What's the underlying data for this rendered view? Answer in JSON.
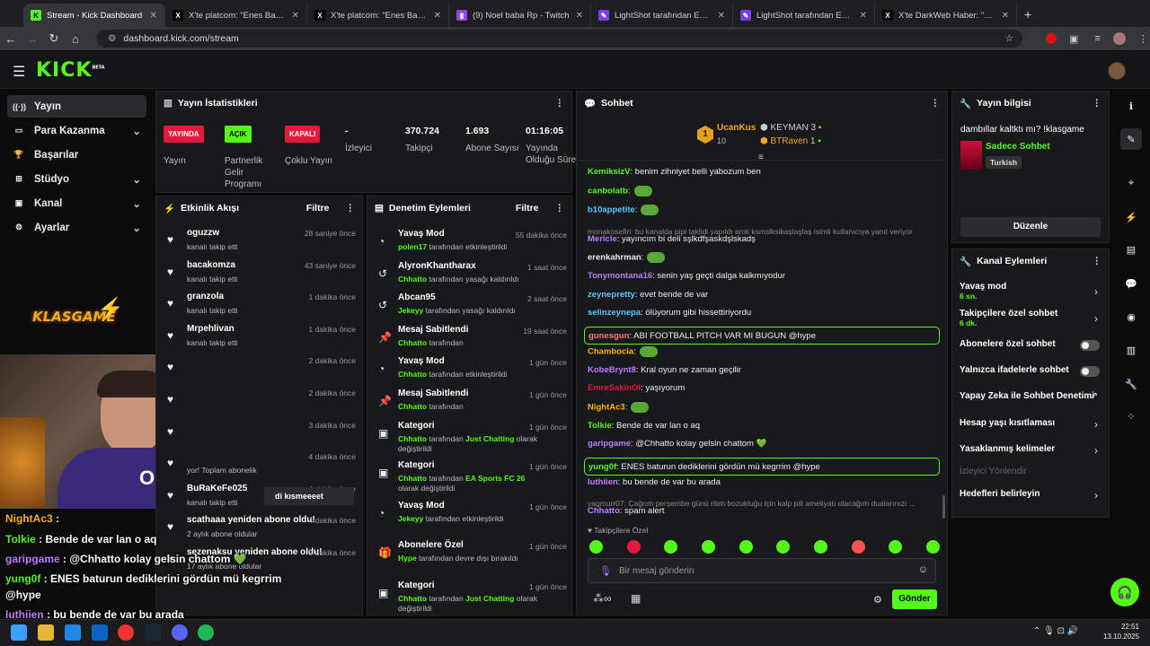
{
  "browser": {
    "tabs": [
      {
        "title": "Stream - Kick Dashboard",
        "active": true,
        "favicon": "kick"
      },
      {
        "title": "X'te platcom: \"Enes Batur, wtch",
        "favicon": "x"
      },
      {
        "title": "X'te platcom: \"Enes Batur, Elrac",
        "favicon": "x"
      },
      {
        "title": "(9) Noel baba Rp - Twitch",
        "favicon": "twitch"
      },
      {
        "title": "LightShot tarafından Ekran Gör",
        "favicon": "lightshot"
      },
      {
        "title": "LightShot tarafından Ekran Gör",
        "favicon": "lightshot"
      },
      {
        "title": "X'te DarkWeb Haber: \"Yerli yap",
        "favicon": "x"
      }
    ],
    "new_tab": "+",
    "url": "dashboard.kick.com/stream"
  },
  "kick": {
    "logo": "KICK",
    "beta": "BETA"
  },
  "nav": {
    "items": [
      {
        "label": "Yayın",
        "icon": "broadcast-icon"
      },
      {
        "label": "Para Kazanma",
        "icon": "money-icon"
      },
      {
        "label": "Başarılar",
        "icon": "trophy-icon"
      },
      {
        "label": "Stüdyo",
        "icon": "studio-icon"
      },
      {
        "label": "Kanal",
        "icon": "channel-icon"
      },
      {
        "label": "Ayarlar",
        "icon": "gear-icon"
      }
    ]
  },
  "stats": {
    "title": "Yayın İstatistikleri",
    "cols": [
      {
        "badge": "YAYINDA",
        "label": "Yayın",
        "color": "#e5193a"
      },
      {
        "badge": "AÇIK",
        "label": "Partnerlik Gelir Programı",
        "color": "#53fc18"
      },
      {
        "badge": "KAPALI",
        "label": "Çoklu Yayın",
        "color": "#e5193a"
      },
      {
        "value": "-",
        "label": "İzleyici"
      },
      {
        "value": "370.724",
        "label": "Takipçi"
      },
      {
        "value": "1.693",
        "label": "Abone Sayısı"
      },
      {
        "value": "01:16:05",
        "label": "Yayında Olduğu Süre"
      }
    ]
  },
  "activity": {
    "title": "Etkinlik Akışı",
    "filter": "Filtre",
    "events": [
      {
        "name": "oguzzw",
        "sub": "kanalı takip etti",
        "time": "28 saniye önce"
      },
      {
        "name": "bacakomza",
        "sub": "kanalı takip etti",
        "time": "43 saniye önce"
      },
      {
        "name": "granzola",
        "sub": "kanalı takip etti",
        "time": "1 dakika önce"
      },
      {
        "name": "Mrpehlivan",
        "sub": "kanalı takip etti",
        "time": "1 dakika önce"
      },
      {
        "name": "",
        "sub": "",
        "time": "2 dakika önce"
      },
      {
        "name": "",
        "sub": "",
        "time": "2 dakika önce"
      },
      {
        "name": "",
        "sub": "",
        "time": "3 dakika önce"
      },
      {
        "name": "",
        "sub": "yor! Toplam abonelik",
        "time": "4 dakika önce"
      },
      {
        "name": "BuRaKeFe025",
        "sub": "kanalı takip etti",
        "time": "4 dakika önce"
      },
      {
        "name": "scathaaa yeniden abone oldu!",
        "sub": "2 aylık abone oldular",
        "time": "4 dakika önce"
      },
      {
        "name": "sezenaksu yeniden abone oldu!",
        "sub": "17 aylık abone oldular",
        "time": "5 dakika önce"
      }
    ],
    "tier_chip": "di kısmeeeet"
  },
  "moderation": {
    "title": "Denetim Eylemleri",
    "filter": "Filtre",
    "items": [
      {
        "name": "Yavaş Mod",
        "who": "polen17",
        "rest": " tarafından etkinleştirildi",
        "time": "55 dakika önce",
        "icon": "slow-mode-icon"
      },
      {
        "name": "AlyronKhantharax",
        "who": "Chhatto",
        "rest": " tarafından yasağı kaldırıldı",
        "time": "1 saat önce",
        "icon": "unban-icon"
      },
      {
        "name": "Abcan95",
        "who": "Jekeyy",
        "rest": " tarafından yasağı kaldırıldı",
        "time": "2 saat önce",
        "icon": "unban-icon"
      },
      {
        "name": "Mesaj Sabitlendi",
        "who": "Chhatto",
        "rest": " tarafından",
        "time": "19 saat önce",
        "icon": "pin-icon"
      },
      {
        "name": "Yavaş Mod",
        "who": "Chhatto",
        "rest": " tarafından etkinleştirildi",
        "time": "1 gün önce",
        "icon": "slow-mode-icon"
      },
      {
        "name": "Mesaj Sabitlendi",
        "who": "Chhatto",
        "rest": " tarafından",
        "time": "1 gün önce",
        "icon": "pin-icon"
      },
      {
        "name": "Kategori",
        "who": "Chhatto",
        "rest": " tarafından ",
        "cat": "Just Chatting",
        "rest2": " olarak değiştirildi",
        "time": "1 gün önce",
        "icon": "category-icon"
      },
      {
        "name": "Kategori",
        "who": "Chhatto",
        "rest": " tarafından ",
        "cat": "EA Sports FC 26",
        "rest2": " olarak değiştirildi",
        "time": "1 gün önce",
        "icon": "category-icon"
      },
      {
        "name": "Yavaş Mod",
        "who": "Jekeyy",
        "rest": " tarafından etkinleştirildi",
        "time": "1 gün önce",
        "icon": "slow-mode-icon"
      },
      {
        "name": "Abonelere Özel",
        "who": "Hype",
        "rest": " tarafından devre dışı bırakıldı",
        "time": "1 gün önce",
        "icon": "gift-icon"
      },
      {
        "name": "Kategori",
        "who": "Chhatto",
        "rest": " tarafından ",
        "cat": "Just Chatting",
        "rest2": " olarak değiştirildi",
        "time": "1 gün önce",
        "icon": "category-icon"
      }
    ]
  },
  "chat": {
    "title": "Sohbet",
    "leaderboard": [
      {
        "rank": "1",
        "name": "UcanKus",
        "count": "10"
      },
      {
        "name": "KEYMAN",
        "count": "3"
      },
      {
        "name": "BTRaven",
        "count": "1"
      }
    ],
    "cutoff": "...",
    "messages": [
      {
        "user": "KemiksizV",
        "color": "#53fc18",
        "text": ": benim zihniyet belli yabozum ben"
      },
      {
        "user": "canbolatb",
        "color": "#53fc18",
        "text": ":",
        "emote": true
      },
      {
        "user": "b10appetite",
        "color": "#5cc8ff",
        "text": ":",
        "emote": true
      },
      {
        "reply": "monakosefiri: bu kanalda pipi taklidi yapıldı amk ksmslksikaşlaşlaş isimli kullanıcıya yanıt veriyor"
      },
      {
        "user": "Mericle",
        "color": "#c07cff",
        "text": ": yayıncım bi deli sşlkdfşaskdşlskadş"
      },
      {
        "user": "erenkahrman",
        "color": "#eeeeee",
        "text": ":",
        "emote": true
      },
      {
        "user": "Tonymontana16",
        "color": "#c07cff",
        "text": ": senin yaş geçti dalga kalkmıyodur"
      },
      {
        "user": "zeynepretty",
        "color": "#5cc8ff",
        "text": ": evet bende de var"
      },
      {
        "user": "selinzeynepa",
        "color": "#5cc8ff",
        "text": ": ölüyorum gibi hissettiriyordu"
      },
      {
        "user": "gunesgun",
        "color": "#ff7a7a",
        "text": ": ABI FOOTBALL PITCH VAR MI BUGUN @hype",
        "highlight": true
      },
      {
        "user": "Chambocia",
        "color": "#ffb020",
        "text": ":",
        "emote": true
      },
      {
        "user": "KobeBrynt8",
        "color": "#c07cff",
        "text": ": Kral oyun ne zaman geçilir"
      },
      {
        "user": "EmreSakinOl",
        "color": "#e5193a",
        "text": ": yaşıyorum"
      },
      {
        "user": "NightAc3",
        "color": "#ffb020",
        "text": ":",
        "emote": true
      },
      {
        "user": "Tolkie",
        "color": "#53fc18",
        "text": ": Bende de var lan o aq"
      },
      {
        "user": "garipgame",
        "color": "#c07cff",
        "text": ": @Chhatto kolay gelsin chattom 💚"
      },
      {
        "user": "yung0f",
        "color": "#53fc18",
        "text": ": ENES baturun dediklerini gördün mü kegrrim @hype",
        "highlight": true
      },
      {
        "user": "luthiien",
        "color": "#c07cff",
        "text": ": bu bende de var bu arada"
      },
      {
        "reply": "yagmurr07: Çağrım perşembe günü ritim bozukluğu için kalp pili ameliyatı olacağım dualarınızı ..."
      },
      {
        "user": "Chhatto",
        "color": "#c07cff",
        "text": ": spam alert"
      }
    ],
    "followers_only": "Takipçilere Özel",
    "input_placeholder": "Bir mesaj gönderin",
    "send": "Gönder"
  },
  "stream_info": {
    "title": "Yayın bilgisi",
    "stream_title": "dambıllar kaltktı mı? !klasgame",
    "category": "Sadece Sohbet",
    "language": "Turkish",
    "edit": "Düzenle"
  },
  "channel_actions": {
    "title": "Kanal Eylemleri",
    "items": [
      {
        "label": "Yavaş mod",
        "sub": "6 sn.",
        "control": "chevron"
      },
      {
        "label": "Takipçilere özel sohbet",
        "sub": "6 dk.",
        "control": "chevron"
      },
      {
        "label": "Abonelere özel sohbet",
        "control": "toggle"
      },
      {
        "label": "Yalnızca ifadelerle sohbet",
        "control": "toggle"
      },
      {
        "label": "Yapay Zeka ile Sohbet Denetimi",
        "control": "external"
      },
      {
        "label": "Hesap yaşı kısıtlaması",
        "control": "chevron"
      },
      {
        "label": "Yasaklanmış kelimeler",
        "control": "chevron"
      },
      {
        "label": "İzleyici Yönlendir",
        "control": "none",
        "disabled": true
      },
      {
        "label": "Hedefleri belirleyin",
        "control": "chevron"
      }
    ]
  },
  "overlay": {
    "brand": "KLASGAME",
    "chat": [
      {
        "user": "NightAc3",
        "color": "#ffb020",
        "text": " :"
      },
      {
        "user": "Tolkie",
        "color": "#53fc18",
        "text": " : Bende de var lan o aq"
      },
      {
        "user": "garipgame",
        "color": "#c07cff",
        "text": " : @Chhatto kolay gelsin chattom 💚"
      },
      {
        "user": "yung0f",
        "color": "#53fc18",
        "text": " : ENES baturun dediklerini gördün mü kegrrim"
      },
      {
        "user": "",
        "color": "#ffffff",
        "text": "@hype"
      },
      {
        "user": "luthiien",
        "color": "#c07cff",
        "text": " : bu bende de var bu arada"
      }
    ]
  },
  "taskbar": {
    "time": "22:51",
    "date": "13.10.2025"
  }
}
